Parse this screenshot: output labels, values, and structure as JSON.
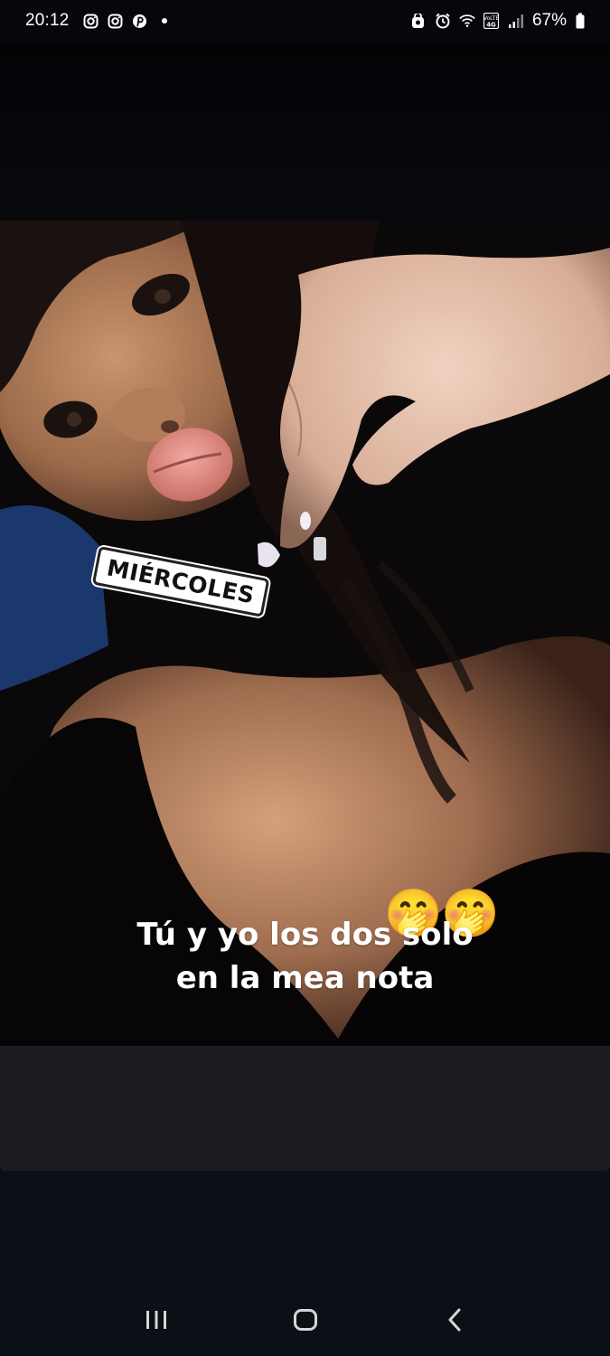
{
  "status_bar": {
    "time": "20:12",
    "notification_icons": [
      "instagram-icon",
      "instagram-icon",
      "pinterest-icon",
      "dot-icon"
    ],
    "system_icons": [
      "sync-icon",
      "alarm-icon",
      "wifi-icon",
      "volte-icon",
      "signal-icon"
    ],
    "battery_percent": "67%"
  },
  "story": {
    "day_sticker": "MIÉRCOLES",
    "caption_line1": "Tú y yo los dos solo",
    "caption_line2": "en la mea nota",
    "emoji_stickers": [
      "🤭",
      "🤭"
    ]
  },
  "nav_bar": {
    "buttons": [
      "recent-apps-icon",
      "home-icon",
      "back-icon"
    ]
  },
  "colors": {
    "status_bar_bg": "#05070b",
    "screen_bg": "#0b0f16",
    "reply_area_bg": "#1b1d20",
    "text": "#ffffff"
  }
}
